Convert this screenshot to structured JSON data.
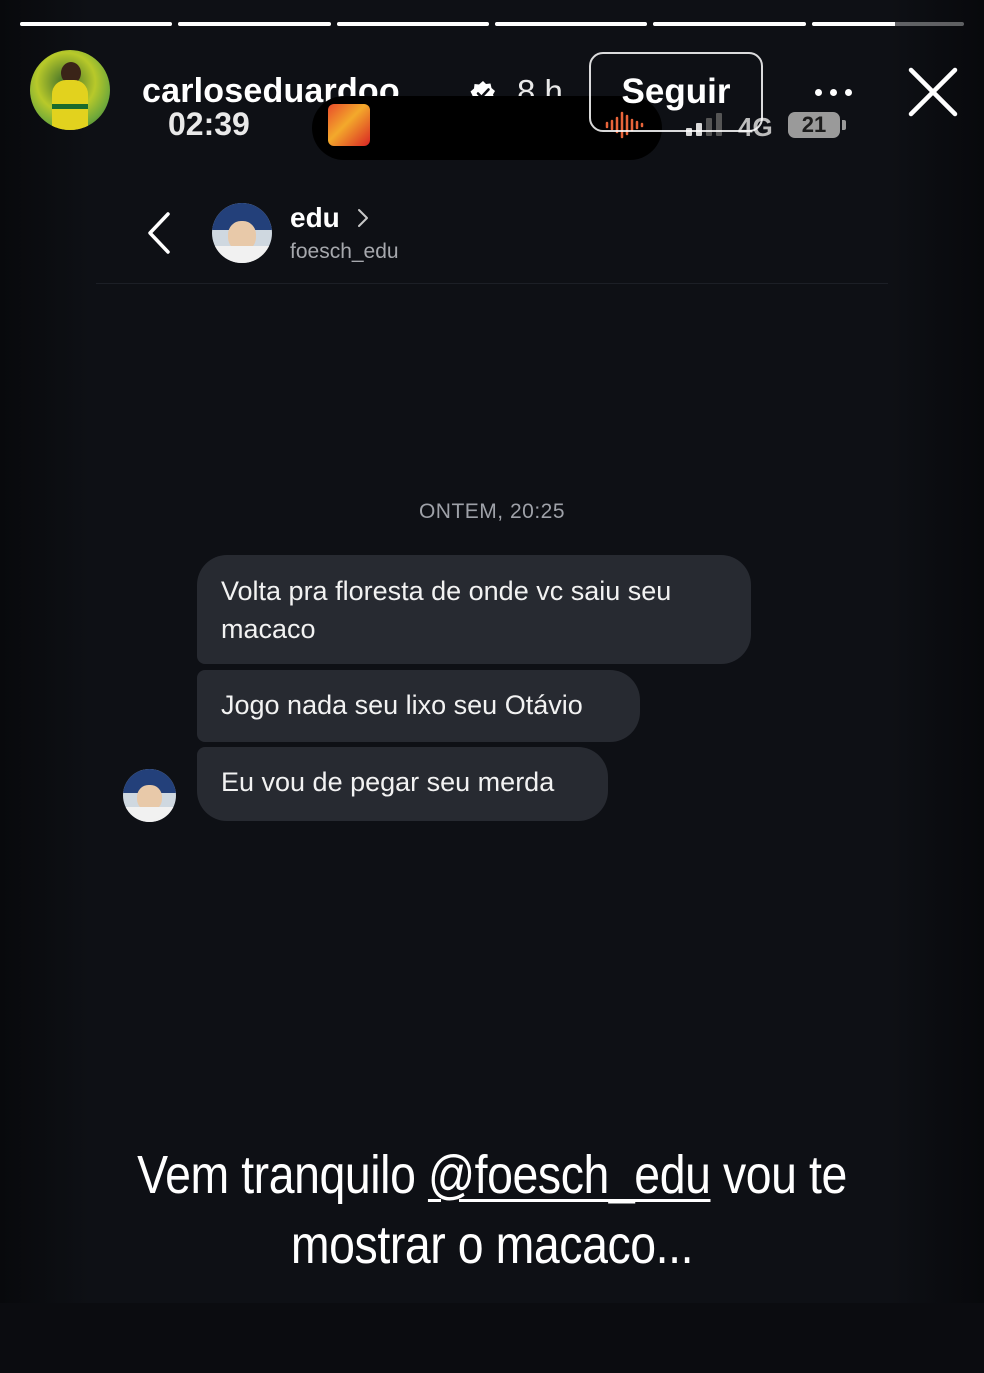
{
  "story": {
    "progress_segments": [
      1,
      1,
      1,
      1,
      1,
      0.55
    ],
    "author": {
      "username": "carloseduardoo_...",
      "age": "8 h",
      "verified": true
    },
    "follow_label": "Seguir",
    "icons": {
      "more": "more-horizontal-icon",
      "close": "close-icon",
      "verified": "verified-badge-icon"
    }
  },
  "phone_status": {
    "time": "02:39",
    "network": "4G",
    "battery": "21"
  },
  "chat": {
    "name": "edu",
    "username": "foesch_edu",
    "timestamp": "ONTEM, 20:25",
    "messages": [
      "Volta pra floresta de onde vc saiu seu macaco",
      "Jogo nada seu lixo seu Otávio",
      "Eu vou de pegar seu merda"
    ]
  },
  "caption": {
    "before": "Vem tranquilo ",
    "mention": "@foesch_edu",
    "after": "  vou te mostrar o macaco..."
  },
  "colors": {
    "background": "#0e1015",
    "bubble": "#272a31",
    "muted_text": "#a6a8ad"
  }
}
